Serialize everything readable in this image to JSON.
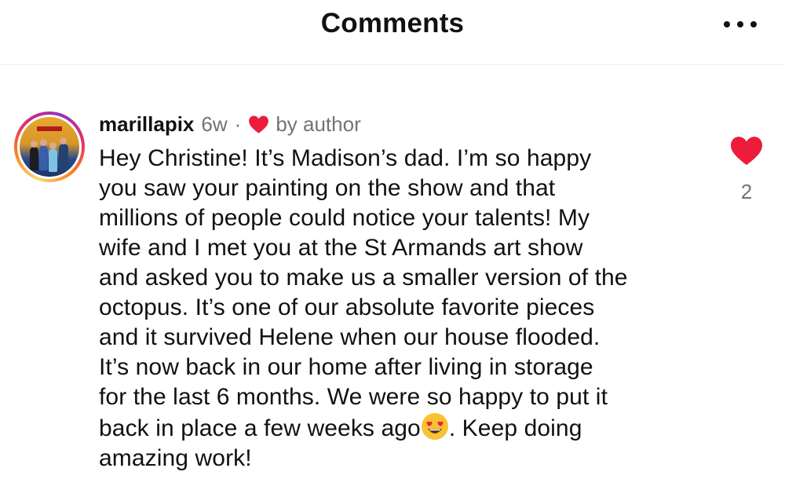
{
  "header": {
    "title": "Comments",
    "more_icon": "more-horizontal-icon"
  },
  "comment": {
    "username": "marillapix",
    "time": "6w",
    "separator": "·",
    "author_like_icon": "heart-icon",
    "by_author": "by author",
    "text_part1": "Hey Christine! It’s Madison’s dad. I’m so happy\nyou saw your painting  on the show and that\nmillions of people could notice your talents! My\nwife and I met you at the St Armands art show\nand asked you to make us a smaller version of the\noctopus. It’s one of our absolute favorite pieces\nand it survived Helene when our house flooded.\nIt’s now back in our home after living in storage\nfor the last 6 months. We were so happy to put it\nback in place a few weeks ago",
    "emoji": "heart-eyes-emoji",
    "text_part2": ". Keep doing\namazing work!",
    "like_count": "2"
  },
  "colors": {
    "heart": "#ed1c3b",
    "muted": "#737373",
    "text": "#111111"
  }
}
